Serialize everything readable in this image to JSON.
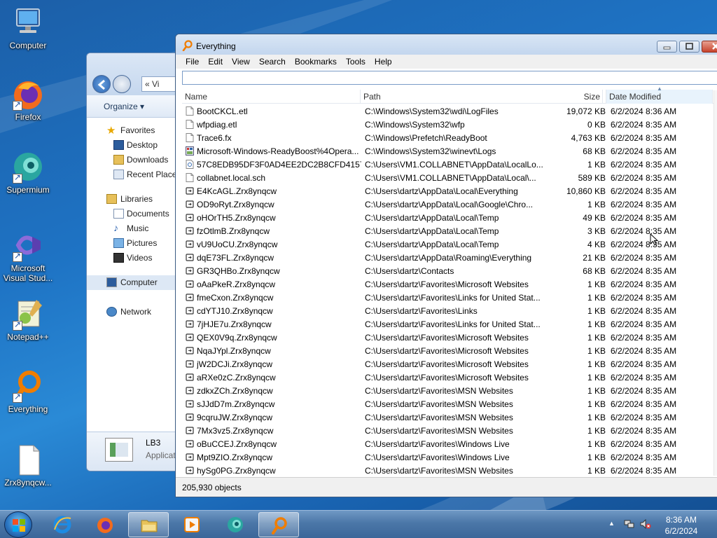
{
  "desktop": {
    "icons": [
      {
        "label": "Computer",
        "icon": "computer-icon"
      },
      {
        "label": "Firefox",
        "icon": "firefox-icon"
      },
      {
        "label": "Supermium",
        "icon": "supermium-icon"
      },
      {
        "label": "Microsoft Visual Stud...",
        "icon": "visual-studio-icon"
      },
      {
        "label": "Notepad++",
        "icon": "notepadpp-icon"
      },
      {
        "label": "Everything",
        "icon": "everything-icon"
      },
      {
        "label": "Zrx8ynqcw...",
        "icon": "file-icon"
      }
    ]
  },
  "explorer": {
    "address": "« Vi",
    "organize_label": "Organize ▾",
    "favorites_label": "Favorites",
    "favorites": [
      "Desktop",
      "Downloads",
      "Recent Places"
    ],
    "libraries_label": "Libraries",
    "libraries": [
      "Documents",
      "Music",
      "Pictures",
      "Videos"
    ],
    "computer_label": "Computer",
    "network_label": "Network",
    "detail_name": "LB3",
    "detail_type": "Applicat"
  },
  "everything": {
    "title": "Everything",
    "menu": [
      "File",
      "Edit",
      "View",
      "Search",
      "Bookmarks",
      "Tools",
      "Help"
    ],
    "search_value": "",
    "columns": {
      "name": "Name",
      "path": "Path",
      "size": "Size",
      "date": "Date Modified"
    },
    "rows": [
      {
        "name": "BootCKCL.etl",
        "path": "C:\\Windows\\System32\\wdi\\LogFiles",
        "size": "19,072 KB",
        "date": "6/2/2024 8:36 AM",
        "icon": "file"
      },
      {
        "name": "wfpdiag.etl",
        "path": "C:\\Windows\\System32\\wfp",
        "size": "0 KB",
        "date": "6/2/2024 8:35 AM",
        "icon": "file"
      },
      {
        "name": "Trace6.fx",
        "path": "C:\\Windows\\Prefetch\\ReadyBoot",
        "size": "4,763 KB",
        "date": "6/2/2024 8:35 AM",
        "icon": "file"
      },
      {
        "name": "Microsoft-Windows-ReadyBoost%4Opera...",
        "path": "C:\\Windows\\System32\\winevt\\Logs",
        "size": "68 KB",
        "date": "6/2/2024 8:35 AM",
        "icon": "evtx"
      },
      {
        "name": "57C8EDB95DF3F0AD4EE2DC2B8CFD4157",
        "path": "C:\\Users\\VM1.COLLABNET\\AppData\\LocalLo...",
        "size": "1 KB",
        "date": "6/2/2024 8:35 AM",
        "icon": "cert"
      },
      {
        "name": "collabnet.local.sch",
        "path": "C:\\Users\\VM1.COLLABNET\\AppData\\Local\\...",
        "size": "589 KB",
        "date": "6/2/2024 8:35 AM",
        "icon": "file"
      },
      {
        "name": "E4KcAGL.Zrx8ynqcw",
        "path": "C:\\Users\\dartz\\AppData\\Local\\Everything",
        "size": "10,860 KB",
        "date": "6/2/2024 8:35 AM",
        "icon": "enc"
      },
      {
        "name": "OD9oRyt.Zrx8ynqcw",
        "path": "C:\\Users\\dartz\\AppData\\Local\\Google\\Chro...",
        "size": "1 KB",
        "date": "6/2/2024 8:35 AM",
        "icon": "enc"
      },
      {
        "name": "oHOrTH5.Zrx8ynqcw",
        "path": "C:\\Users\\dartz\\AppData\\Local\\Temp",
        "size": "49 KB",
        "date": "6/2/2024 8:35 AM",
        "icon": "enc"
      },
      {
        "name": "fzOtlmB.Zrx8ynqcw",
        "path": "C:\\Users\\dartz\\AppData\\Local\\Temp",
        "size": "3 KB",
        "date": "6/2/2024 8:35 AM",
        "icon": "enc"
      },
      {
        "name": "vU9UoCU.Zrx8ynqcw",
        "path": "C:\\Users\\dartz\\AppData\\Local\\Temp",
        "size": "4 KB",
        "date": "6/2/2024 8:35 AM",
        "icon": "enc"
      },
      {
        "name": "dqE73FL.Zrx8ynqcw",
        "path": "C:\\Users\\dartz\\AppData\\Roaming\\Everything",
        "size": "21 KB",
        "date": "6/2/2024 8:35 AM",
        "icon": "enc"
      },
      {
        "name": "GR3QHBo.Zrx8ynqcw",
        "path": "C:\\Users\\dartz\\Contacts",
        "size": "68 KB",
        "date": "6/2/2024 8:35 AM",
        "icon": "enc"
      },
      {
        "name": "oAaPkeR.Zrx8ynqcw",
        "path": "C:\\Users\\dartz\\Favorites\\Microsoft Websites",
        "size": "1 KB",
        "date": "6/2/2024 8:35 AM",
        "icon": "enc"
      },
      {
        "name": "fmeCxon.Zrx8ynqcw",
        "path": "C:\\Users\\dartz\\Favorites\\Links for United Stat...",
        "size": "1 KB",
        "date": "6/2/2024 8:35 AM",
        "icon": "enc"
      },
      {
        "name": "cdYTJ10.Zrx8ynqcw",
        "path": "C:\\Users\\dartz\\Favorites\\Links",
        "size": "1 KB",
        "date": "6/2/2024 8:35 AM",
        "icon": "enc"
      },
      {
        "name": "7jHJE7u.Zrx8ynqcw",
        "path": "C:\\Users\\dartz\\Favorites\\Links for United Stat...",
        "size": "1 KB",
        "date": "6/2/2024 8:35 AM",
        "icon": "enc"
      },
      {
        "name": "QEX0V9q.Zrx8ynqcw",
        "path": "C:\\Users\\dartz\\Favorites\\Microsoft Websites",
        "size": "1 KB",
        "date": "6/2/2024 8:35 AM",
        "icon": "enc"
      },
      {
        "name": "NqaJYpl.Zrx8ynqcw",
        "path": "C:\\Users\\dartz\\Favorites\\Microsoft Websites",
        "size": "1 KB",
        "date": "6/2/2024 8:35 AM",
        "icon": "enc"
      },
      {
        "name": "jW2DCJi.Zrx8ynqcw",
        "path": "C:\\Users\\dartz\\Favorites\\Microsoft Websites",
        "size": "1 KB",
        "date": "6/2/2024 8:35 AM",
        "icon": "enc"
      },
      {
        "name": "aRXe0zC.Zrx8ynqcw",
        "path": "C:\\Users\\dartz\\Favorites\\Microsoft Websites",
        "size": "1 KB",
        "date": "6/2/2024 8:35 AM",
        "icon": "enc"
      },
      {
        "name": "zdkxZCh.Zrx8ynqcw",
        "path": "C:\\Users\\dartz\\Favorites\\MSN Websites",
        "size": "1 KB",
        "date": "6/2/2024 8:35 AM",
        "icon": "enc"
      },
      {
        "name": "sJJdD7m.Zrx8ynqcw",
        "path": "C:\\Users\\dartz\\Favorites\\MSN Websites",
        "size": "1 KB",
        "date": "6/2/2024 8:35 AM",
        "icon": "enc"
      },
      {
        "name": "9cqruJW.Zrx8ynqcw",
        "path": "C:\\Users\\dartz\\Favorites\\MSN Websites",
        "size": "1 KB",
        "date": "6/2/2024 8:35 AM",
        "icon": "enc"
      },
      {
        "name": "7Mx3vz5.Zrx8ynqcw",
        "path": "C:\\Users\\dartz\\Favorites\\MSN Websites",
        "size": "1 KB",
        "date": "6/2/2024 8:35 AM",
        "icon": "enc"
      },
      {
        "name": "oBuCCEJ.Zrx8ynqcw",
        "path": "C:\\Users\\dartz\\Favorites\\Windows Live",
        "size": "1 KB",
        "date": "6/2/2024 8:35 AM",
        "icon": "enc"
      },
      {
        "name": "Mpt9ZIO.Zrx8ynqcw",
        "path": "C:\\Users\\dartz\\Favorites\\Windows Live",
        "size": "1 KB",
        "date": "6/2/2024 8:35 AM",
        "icon": "enc"
      },
      {
        "name": "hySg0PG.Zrx8ynqcw",
        "path": "C:\\Users\\dartz\\Favorites\\MSN Websites",
        "size": "1 KB",
        "date": "6/2/2024 8:35 AM",
        "icon": "enc"
      }
    ],
    "status": "205,930 objects"
  },
  "taskbar": {
    "apps": [
      "internet-explorer-icon",
      "firefox-icon",
      "explorer-icon",
      "media-player-icon",
      "supermium-icon",
      "everything-icon"
    ],
    "active_app": "everything-icon",
    "time": "8:36 AM",
    "date": "6/2/2024"
  },
  "colors": {
    "accent": "#3b6699",
    "selection": "#e8f3fc",
    "everything_orange": "#f07d00"
  }
}
